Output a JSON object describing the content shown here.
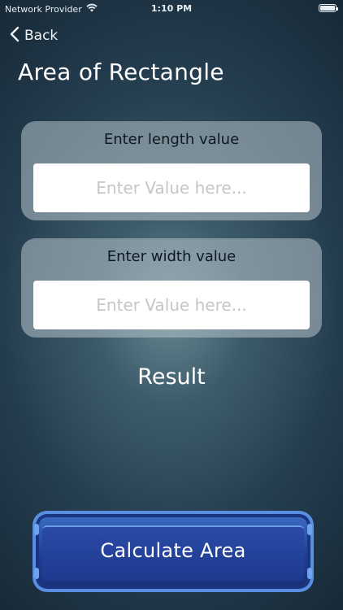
{
  "status_bar": {
    "carrier": "Network Provider",
    "time": "1:10 PM",
    "wifi_icon": "wifi-icon",
    "battery_icon": "battery-icon"
  },
  "nav": {
    "back_label": "Back",
    "back_icon": "chevron-left-icon"
  },
  "page": {
    "title": "Area of Rectangle"
  },
  "inputs": [
    {
      "label": "Enter length value",
      "placeholder": "Enter Value here...",
      "value": ""
    },
    {
      "label": "Enter width value",
      "placeholder": "Enter Value here...",
      "value": ""
    }
  ],
  "result_label": "Result",
  "calculate_button": {
    "label": "Calculate Area"
  },
  "colors": {
    "background_dark": "#0f1c28",
    "background_center": "#3c5e6e",
    "card": "#b0bec4",
    "button_blue": "#1f3f93",
    "button_trim": "#5a8ee0"
  }
}
